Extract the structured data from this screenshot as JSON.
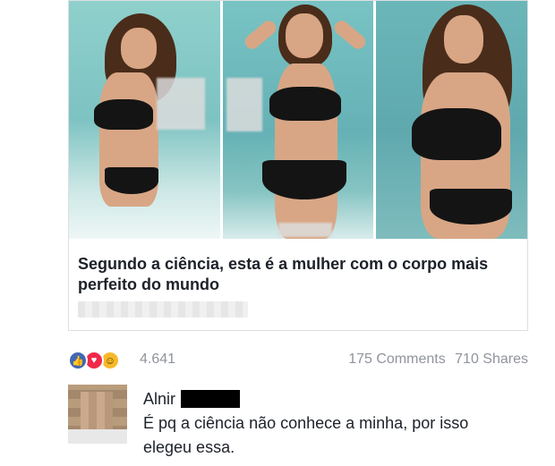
{
  "post": {
    "image_alt": "three beach photos of a woman in a black bikini",
    "caption": "Segundo a ciência, esta é a mulher com o corpo mais perfeito do mundo"
  },
  "reactions": {
    "icons": [
      "like-icon",
      "love-icon",
      "wow-icon"
    ],
    "count": "4.641"
  },
  "stats": {
    "comments": "175 Comments",
    "shares": "710 Shares"
  },
  "comment": {
    "author": "Alnir",
    "text": "É pq a ciência não conhece a minha, por isso elegeu essa."
  },
  "colors": {
    "like": "#4267b2",
    "love": "#f0284a",
    "wow": "#f7b928",
    "meta_text": "#90949c"
  }
}
